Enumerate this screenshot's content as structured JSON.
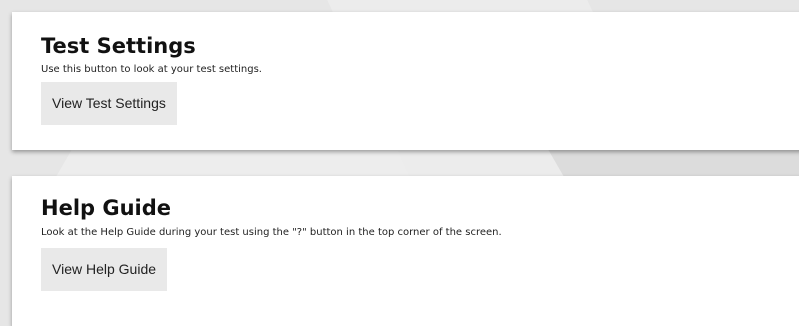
{
  "test_settings": {
    "title": "Test Settings",
    "description": "Use this button to look at your test settings.",
    "button_label": "View Test Settings"
  },
  "help_guide": {
    "title": "Help Guide",
    "description": "Look at the Help Guide during your test using the \"?\" button in the top corner of the screen.",
    "button_label": "View Help Guide"
  },
  "colors": {
    "page_background": "#e6e6e6",
    "card_background": "#ffffff",
    "button_background": "#e9e9e9"
  }
}
